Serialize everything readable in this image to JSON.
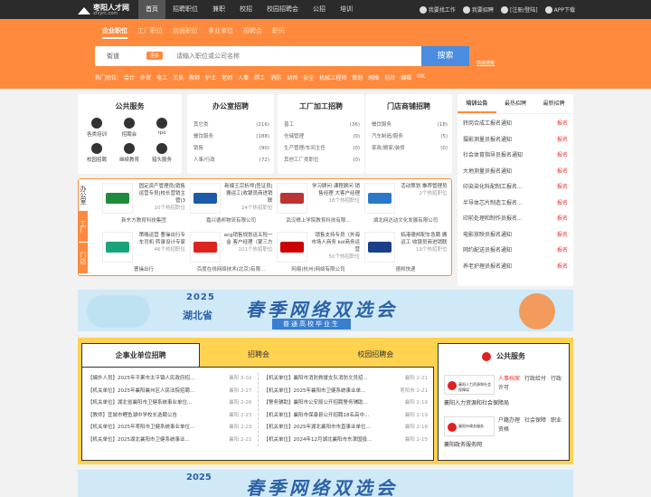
{
  "site": {
    "name": "枣阳人才网",
    "domain": "xfzyrc.com"
  },
  "topnav": [
    "首页",
    "招聘职位",
    "兼职",
    "校招",
    "校园招聘会",
    "公招",
    "培训"
  ],
  "topright": {
    "find_job": "我要找工作",
    "recruit": "我要招聘",
    "login": "[注册/登陆]",
    "app": "APP下载"
  },
  "search": {
    "tabs": [
      "企业职位",
      "工厂职位",
      "店面职位",
      "事业单位",
      "招聘会",
      "职讯"
    ],
    "city": "街道",
    "badge": "更多",
    "placeholder": "请输入职位或公司名称",
    "button": "搜索",
    "advanced": "高级搜索"
  },
  "hot": {
    "label": "热门职位:",
    "items": [
      "会计",
      "外贸",
      "电工",
      "文员",
      "教师",
      "护士",
      "老师",
      "人事",
      "焊工",
      "消防",
      "幼师",
      "安全",
      "机械工程师",
      "策划",
      "网络",
      "前台",
      "编辑",
      "OK"
    ]
  },
  "public_service": {
    "title": "公共服务",
    "items": [
      "各类培训",
      "招聘会",
      "rpo",
      "校园招聘",
      "继续教育",
      "猎头服务"
    ]
  },
  "columns": [
    {
      "title": "办公室招聘",
      "items": [
        {
          "n": "其它类",
          "c": "(216)"
        },
        {
          "n": "餐饮服务",
          "c": "(188)"
        },
        {
          "n": "销售",
          "c": "(90)"
        },
        {
          "n": "人事/行政",
          "c": "(72)"
        }
      ]
    },
    {
      "title": "工厂加工招聘",
      "items": [
        {
          "n": "普工",
          "c": "(36)"
        },
        {
          "n": "仓储管理",
          "c": "(0)"
        },
        {
          "n": "生产管理/车间主任",
          "c": "(0)"
        },
        {
          "n": "其他工厂类职位",
          "c": "(0)"
        }
      ]
    },
    {
      "title": "门店商铺招聘",
      "items": [
        {
          "n": "餐饮服务",
          "c": "(18)"
        },
        {
          "n": "汽车制造/服务",
          "c": "(5)"
        },
        {
          "n": "家政/搬家/装修",
          "c": "(0)"
        },
        {
          "n": "",
          "c": ""
        }
      ]
    }
  ],
  "announcements": {
    "tabs": [
      "培训公告",
      "最热招聘",
      "最新招聘"
    ],
    "items": [
      {
        "t": "转岗合成工报名通知",
        "s": "报名"
      },
      {
        "t": "摄影测量员报名通知",
        "s": "报名"
      },
      {
        "t": "社会体育指导员报名通知",
        "s": "报名"
      },
      {
        "t": "大地测量员报名通知",
        "s": "报名"
      },
      {
        "t": "印染染化料配制工报名...",
        "s": "报名"
      },
      {
        "t": "半导体芯片制造工报名...",
        "s": "报名"
      },
      {
        "t": "印前处理和制作员报名...",
        "s": "报名"
      },
      {
        "t": "电影放映员报名通知",
        "s": "报名"
      },
      {
        "t": "网约配送员报名通知",
        "s": "报名"
      },
      {
        "t": "养老护理员报名通知",
        "s": "报名"
      }
    ]
  },
  "feature": {
    "tabs": [
      "办公室",
      "工厂",
      "门店"
    ],
    "companies": [
      {
        "desc": "固定资产管理员|销售运营专员|校长营销主管|3",
        "sub": "10个热招职位",
        "name": "新东方教育科技集团",
        "color": "#1f8a3a"
      },
      {
        "desc": "新媒王宗析师|签证员|搬运工|收银员商进销联",
        "sub": "24个热招职位",
        "name": "嘉兴德邦物流有限公司",
        "color": "#1c5aa8"
      },
      {
        "desc": "学习顾问 课程顾问 销售经理 大客户经理",
        "sub": "18个热招职位",
        "name": "武汉樟上学院教育科技有限...",
        "color": "#b33"
      },
      {
        "desc": "活动策划 推荐管理员",
        "sub": "2个热招职位",
        "name": "湖北网达动文化发展有限公司",
        "color": "#2a78c7"
      },
      {
        "desc": "策略运营 曹操出行专车司机 转录设计专家",
        "sub": "46个热招职位",
        "name": "曹操出行",
        "color": "#1aa37a"
      },
      {
        "desc": "acg销售规划运五险一金 客户经理（蒙三方",
        "sub": "101个热招职位",
        "name": "百度在线网络技术(北京)有限...",
        "color": "#d22"
      },
      {
        "desc": "销售支持专员（外海市场人商务 kol商务运营",
        "sub": "50个热招职位",
        "name": "网易(杭州)网络有限公司",
        "color": "#c00"
      },
      {
        "desc": "临港德邦配车急聘 搬运工 收银员商进销联",
        "sub": "19个热招职位",
        "name": "德邦快递",
        "color": "#1c3f8a"
      }
    ]
  },
  "banner": {
    "year": "2025",
    "province": "湖北省",
    "title": "春季网络双选会",
    "subtitle": "普通高校毕业生"
  },
  "jobs": {
    "tabs": [
      "企事业单位招聘",
      "招聘会",
      "校园招聘会"
    ],
    "left": [
      {
        "t": "【编外人员】2025年平果市太平镇人民政府招...",
        "m": "襄阳 3-02"
      },
      {
        "t": "【机关单位】2025年襄阳襄州区人民法院招聘...",
        "m": "襄阳 2-27"
      },
      {
        "t": "【机关单位】湖北省襄阳市卫健系统事业单位...",
        "m": "襄阳 2-26"
      },
      {
        "t": "【教师】宜城市鲤鱼湖中学校长选聘公告",
        "m": "襄阳 2-23"
      },
      {
        "t": "【机关单位】2025年枣阳市卫健系统事业单位...",
        "m": "襄阳 2-23"
      },
      {
        "t": "【机关单位】2025湖北襄阳市卫健系统事业...",
        "m": "襄阳 2-21"
      }
    ],
    "right": [
      {
        "t": "【机关单位】襄阳市消防救援支队消防文员招...",
        "m": "襄阳 2-21"
      },
      {
        "t": "【机关单位】2025年襄阳市卫健系统事业单...",
        "m": "枣阳市 2-21"
      },
      {
        "t": "【警务辅助】襄阳市公安局公开招聘警务辅助...",
        "m": "襄阳 2-19"
      },
      {
        "t": "【机关单位】襄阳市保康县公开招聘18名高中...",
        "m": "襄阳 2-19"
      },
      {
        "t": "【机关单位】2025年湖北襄阳市市直事业单位...",
        "m": "襄阳 2-18"
      },
      {
        "t": "【机关单位】2024年12月湖北襄阳市东津国投...",
        "m": "襄阳 2-15"
      }
    ]
  },
  "ypub": {
    "title": "公共服务",
    "orgs": [
      {
        "logo": "襄阳人力资源和社会保障局",
        "links": [
          "人事档案",
          "行政给付",
          "行政许可"
        ],
        "name": "襄阳人力资源和社会保障局"
      },
      {
        "logo": "襄阳市政务服务",
        "links": [
          "户籍办理",
          "社会保障",
          "职业资格"
        ],
        "name": "襄阳政务服务网"
      }
    ]
  }
}
